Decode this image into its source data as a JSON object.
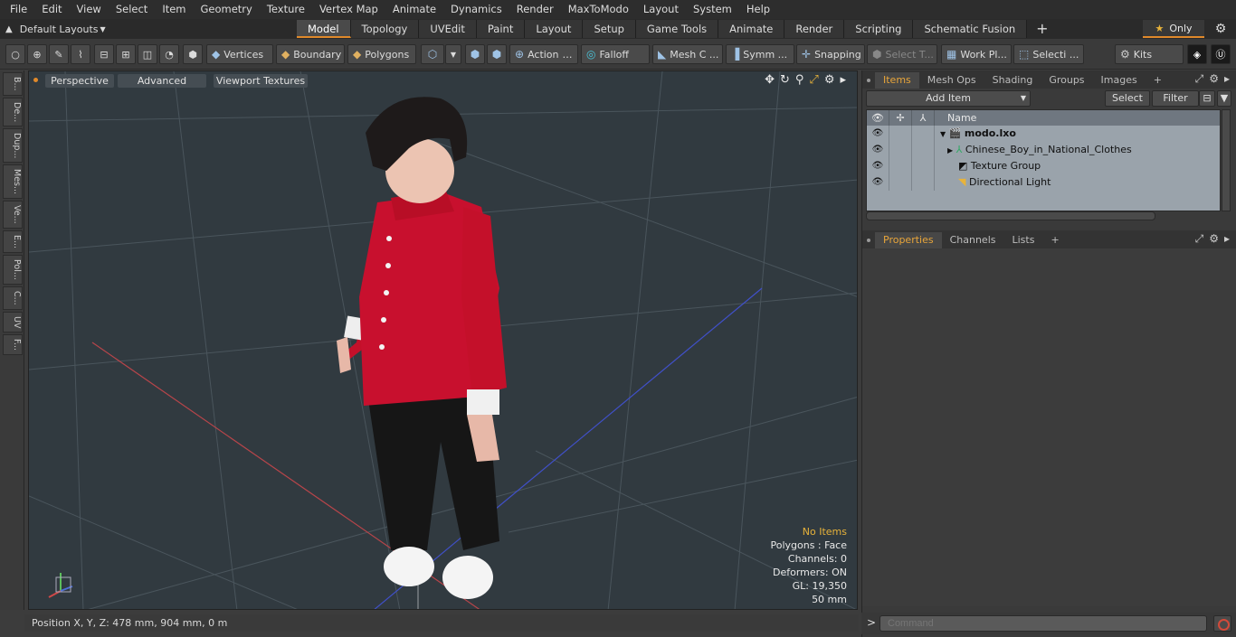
{
  "menu": [
    "File",
    "Edit",
    "View",
    "Select",
    "Item",
    "Geometry",
    "Texture",
    "Vertex Map",
    "Animate",
    "Dynamics",
    "Render",
    "MaxToModo",
    "Layout",
    "System",
    "Help"
  ],
  "layout_selector": "Default Layouts",
  "tabs": [
    {
      "label": "Model",
      "active": true
    },
    {
      "label": "Topology"
    },
    {
      "label": "UVEdit"
    },
    {
      "label": "Paint"
    },
    {
      "label": "Layout"
    },
    {
      "label": "Setup"
    },
    {
      "label": "Game Tools"
    },
    {
      "label": "Animate"
    },
    {
      "label": "Render"
    },
    {
      "label": "Scripting"
    },
    {
      "label": "Schematic Fusion"
    }
  ],
  "only_label": "Only",
  "toolbar": {
    "vertices": "Vertices",
    "boundary": "Boundary",
    "polygons": "Polygons",
    "action": "Action",
    "falloff": "Falloff",
    "mesh": "Mesh C ...",
    "symm": "Symm ...",
    "snapping": "Snapping",
    "select_t": "Select T...",
    "workpl": "Work Pl...",
    "selecti": "Selecti ...",
    "kits": "Kits"
  },
  "left_tabs": [
    "B...",
    "De...",
    "Dup...",
    "Mes...",
    "Ve...",
    "E...",
    "Pol...",
    "C...",
    "UV",
    "F..."
  ],
  "viewport": {
    "perspective": "Perspective",
    "advanced": "Advanced",
    "textures": "Viewport Textures",
    "stats": {
      "items": "No Items",
      "polygons": "Polygons : Face",
      "channels": "Channels: 0",
      "deformers": "Deformers: ON",
      "gl": "GL: 19,350",
      "scale": "50 mm"
    }
  },
  "status": "Position X, Y, Z:   478 mm, 904 mm, 0 m",
  "items_panel": {
    "tabs": [
      "Items",
      "Mesh Ops",
      "Shading",
      "Groups",
      "Images"
    ],
    "add_item": "Add Item",
    "select": "Select",
    "filter": "Filter",
    "name_header": "Name",
    "rows": [
      {
        "name": "modo.lxo"
      },
      {
        "name": "Chinese_Boy_in_National_Clothes"
      },
      {
        "name": "Texture Group"
      },
      {
        "name": "Directional Light"
      }
    ]
  },
  "props_panel": {
    "tabs": [
      "Properties",
      "Channels",
      "Lists"
    ]
  },
  "command_placeholder": "Command",
  "colors": {
    "accent": "#e0892a",
    "viewport_bg": "#313a40",
    "shirt": "#c8102e"
  }
}
